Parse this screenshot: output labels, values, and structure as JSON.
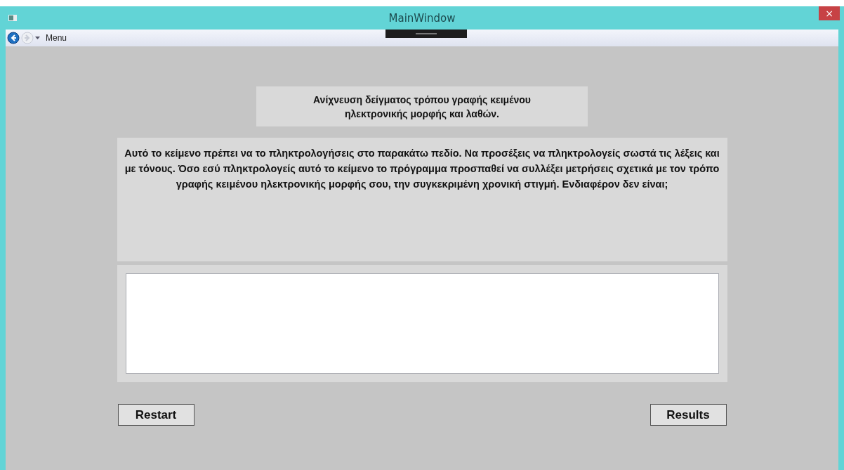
{
  "window": {
    "title": "MainWindow",
    "close": "×"
  },
  "toolbar": {
    "menu": "Menu",
    "back_enabled": true,
    "forward_enabled": false
  },
  "heading": "Ανίχνευση δείγματος τρόπου γραφής κειμένου ηλεκτρονικής μορφής και λαθών.",
  "instructions": "Αυτό το κείμενο πρέπει να το πληκτρολογήσεις στο παρακάτω πεδίο. Να προσέξεις να πληκτρολογείς σωστά τις λέξεις και με τόνους. Όσο εσύ πληκτρολογείς αυτό το κείμενο το πρόγραμμα προσπαθεί να συλλέξει μετρήσεις σχετικά με τον τρόπο γραφής κειμένου ηλεκτρονικής μορφής σου, την συγκεκριμένη χρονική στιγμή. Ενδιαφέρον δεν είναι;",
  "buttons": [
    "Restart",
    "Results"
  ]
}
